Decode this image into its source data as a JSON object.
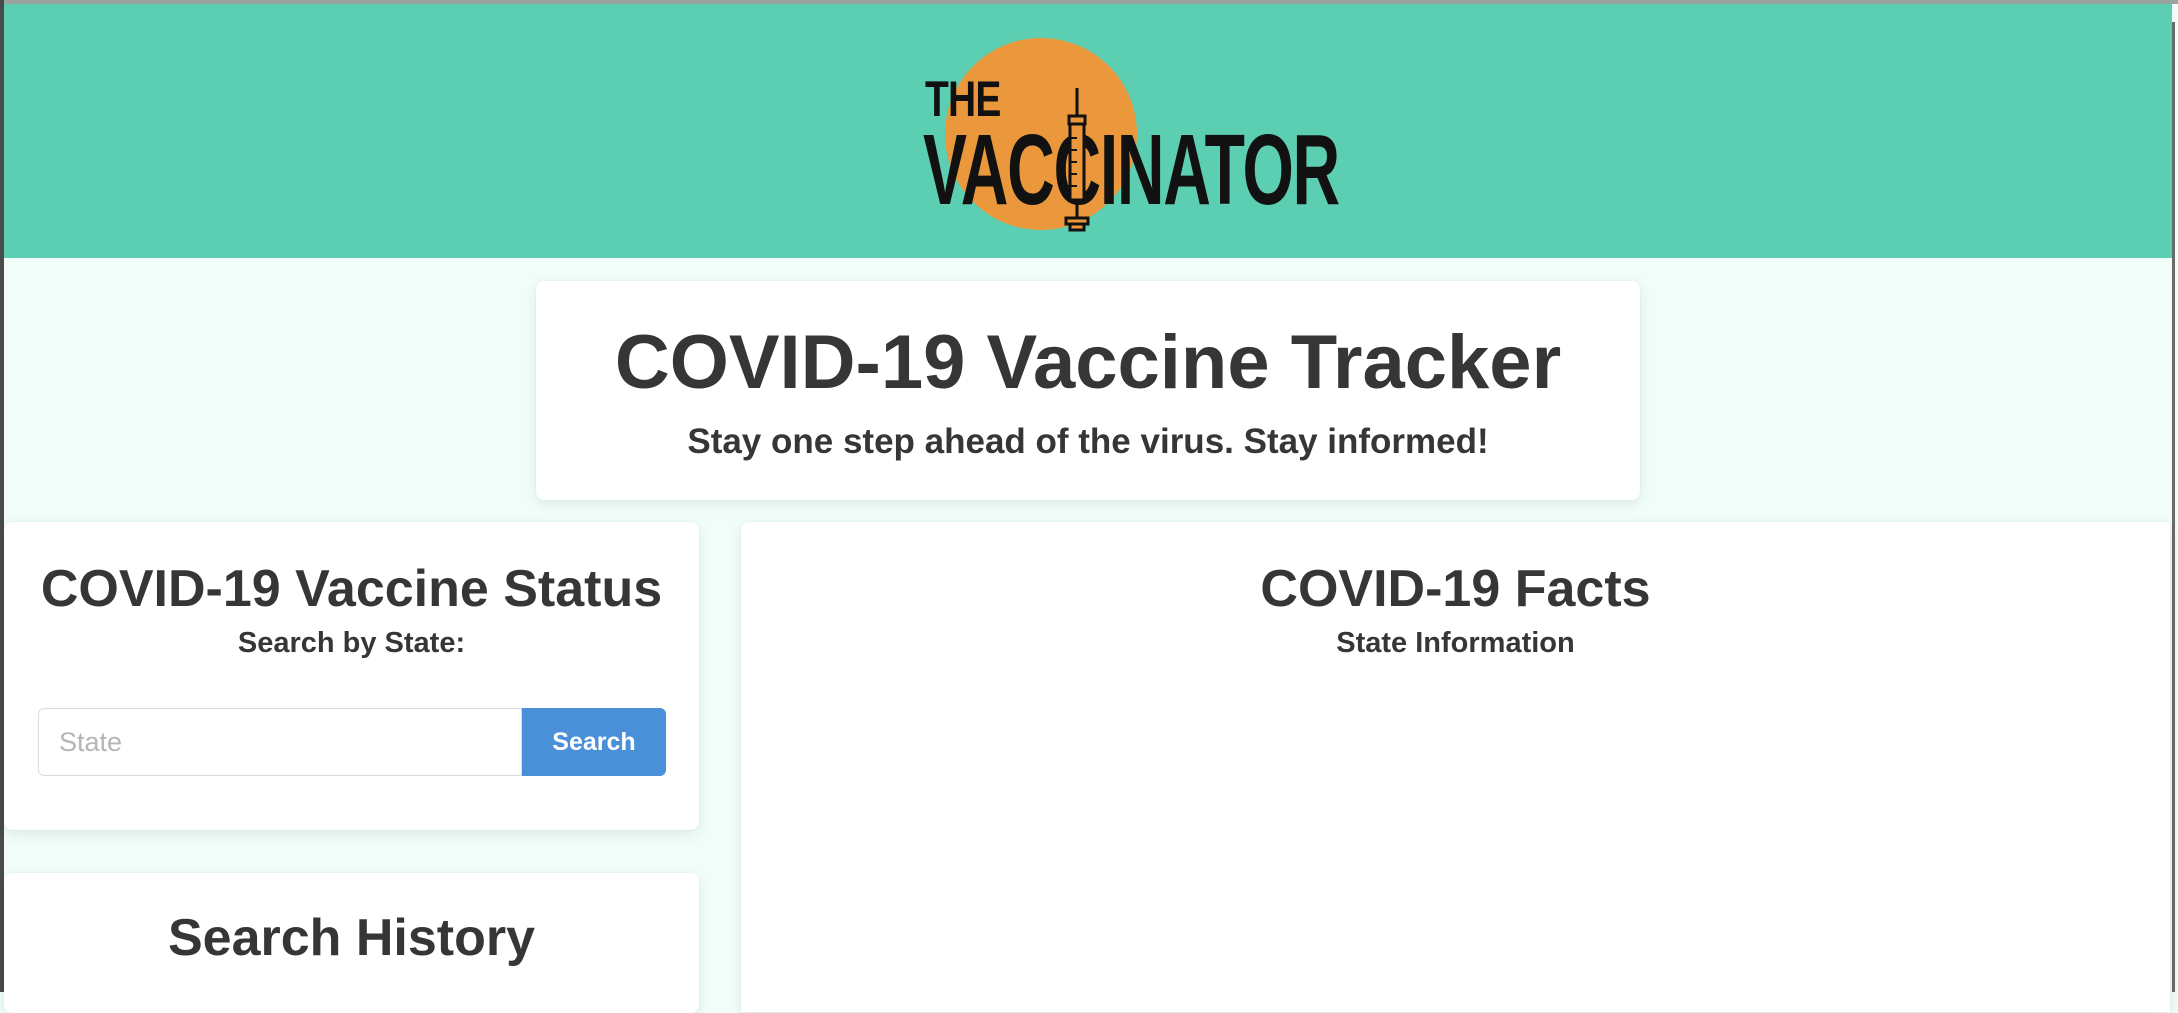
{
  "header": {
    "logo_line1": "THE",
    "logo_line2": "VACCINATOR",
    "accent_color": "#5ccfb2",
    "logo_circle_color": "#eb983d"
  },
  "hero": {
    "title": "COVID-19 Vaccine Tracker",
    "subtitle": "Stay one step ahead of the virus. Stay informed!"
  },
  "status_panel": {
    "title": "COVID-19 Vaccine Status",
    "subtitle": "Search by State:",
    "input_placeholder": "State",
    "input_value": "",
    "search_label": "Search",
    "button_color": "#4a90d9"
  },
  "history_panel": {
    "title": "Search History"
  },
  "facts_panel": {
    "title": "COVID-19 Facts",
    "subtitle": "State Information"
  }
}
